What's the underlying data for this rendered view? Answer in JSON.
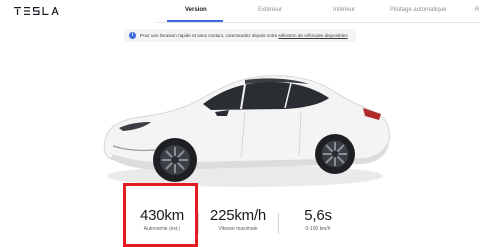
{
  "brand": {
    "logo": "TESLA",
    "logo_icon": "tesla-wordmark"
  },
  "nav": {
    "steps": [
      {
        "label": "Version"
      },
      {
        "label": "Extérieur"
      },
      {
        "label": "Intérieur"
      },
      {
        "label": "Pilotage automatique"
      },
      {
        "label": "R"
      }
    ],
    "active_step": "Version",
    "accent_color": "#3e6ae1"
  },
  "notice": {
    "icon": "info-icon",
    "text": "Pour une livraison rapide et sans contact, commandez depuis notre ",
    "link_text": "sélection de véhicules disponibles"
  },
  "car": {
    "alt": "Tesla Model 3 white",
    "color": "#f2f2f2"
  },
  "stats": [
    {
      "value": "430km",
      "label": "Autonomie (est.)"
    },
    {
      "value": "225km/h",
      "label": "Vitesse maximale"
    },
    {
      "value": "5,6s",
      "label": "0-100 km/h"
    }
  ],
  "highlight_color": "#e31b23"
}
